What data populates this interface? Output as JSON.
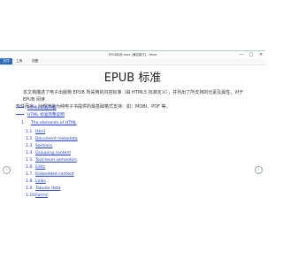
{
  "window": {
    "title": "EPUB标准.docx [兼容模式] - Word",
    "controls": {
      "minimize": "—",
      "maximize": "□",
      "close": "✕"
    }
  },
  "menu": {
    "active_tab": "文件",
    "items": [
      "工具",
      "视图"
    ]
  },
  "document": {
    "title": "EPUB 标准",
    "intro_line1": "本文档描述了电子出版物 EPUB 所采用的内容标准（由 HTML5 标准定义），并列出了所支持的元素及属性。对于 EPUB 阅读",
    "intro_line2": "软件而言，此规范是为纯电子书提供的最基础格式支持：如：MOBI、PDF 等。",
    "toc": [
      {
        "label": "HTML 标准内容"
      },
      {
        "label": "HTML 标准完整说明"
      }
    ],
    "section_heading": {
      "num": "1.",
      "label": "The elements of HTML"
    },
    "subsections": [
      {
        "num": "1.1.",
        "label": "Html"
      },
      {
        "num": "1.2.",
        "label": "Document metadata"
      },
      {
        "num": "1.3.",
        "label": "Sections"
      },
      {
        "num": "1.4.",
        "label": "Grouping content"
      },
      {
        "num": "1.5.",
        "label": "Text-level semantics"
      },
      {
        "num": "1.6.",
        "label": "Edits"
      },
      {
        "num": "1.7.",
        "label": "Embedded content"
      },
      {
        "num": "1.8.",
        "label": "Links"
      },
      {
        "num": "1.9.",
        "label": "Tabular data"
      },
      {
        "num": "1.10.",
        "label": "Forms"
      }
    ]
  },
  "nav": {
    "prev": "‹",
    "next": "›"
  }
}
